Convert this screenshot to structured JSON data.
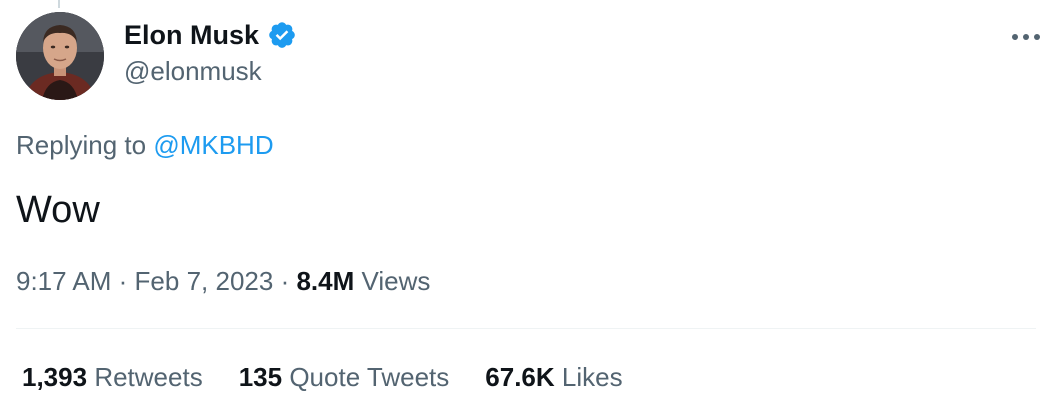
{
  "author": {
    "display_name": "Elon Musk",
    "handle": "@elonmusk",
    "verified": true,
    "verified_color": "#1d9bf0",
    "avatar_icon": "profile-photo"
  },
  "reply": {
    "prefix": "Replying to",
    "mention": "@MKBHD"
  },
  "tweet": {
    "text": "Wow"
  },
  "meta": {
    "time": "9:17 AM",
    "separator": "·",
    "date": "Feb 7, 2023",
    "views_count": "8.4M",
    "views_label": "Views"
  },
  "stats": {
    "retweets_count": "1,393",
    "retweets_label": "Retweets",
    "quotes_count": "135",
    "quotes_label": "Quote Tweets",
    "likes_count": "67.6K",
    "likes_label": "Likes"
  },
  "icons": {
    "more": "more-horizontal-icon",
    "verified": "verified-badge-icon"
  },
  "colors": {
    "text_primary": "#0f1419",
    "text_secondary": "#536471",
    "accent": "#1d9bf0",
    "divider": "#eff3f4"
  }
}
